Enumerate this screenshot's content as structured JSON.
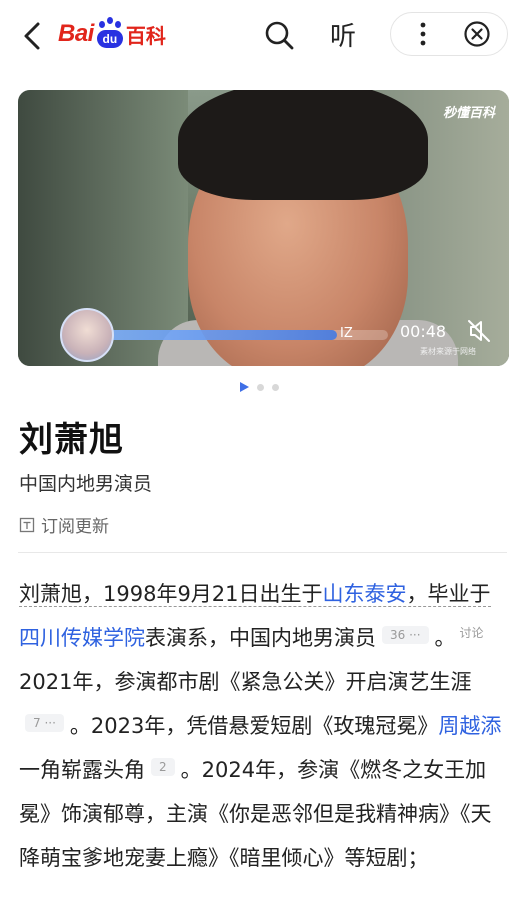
{
  "header": {
    "logo_bai": "Bai",
    "logo_du": "du",
    "logo_baike": "百科",
    "listen_label": "听"
  },
  "video": {
    "watermark": "秒懂百科",
    "marker": "IZ",
    "time": "00:48",
    "credit": "素材来源于网络",
    "progress": 0.83
  },
  "carousel": {
    "count": 3,
    "active": 0
  },
  "entry": {
    "title": "刘萧旭",
    "subtitle": "中国内地男演员",
    "subscribe_label": "订阅更新"
  },
  "paragraph": {
    "s1": "刘萧旭，",
    "s2": "1998年9月21日出生于",
    "link_place": "山东泰安",
    "s3": "，毕业于",
    "link_school": "四川传媒学院",
    "s4": "表演系，中国内地男演员",
    "ref1": "36 ···",
    "s5": "。",
    "discuss": "讨论",
    "s6": "2021年，参演都市剧《紧急公关》开启演艺生涯",
    "ref2": "7 ···",
    "s7": "。2023年，凭借悬爱短剧《玫瑰冠冕》",
    "link_person": "周越添",
    "s8": "一角崭露头角",
    "ref3": "2",
    "s9": "。2024年，参演《燃冬之女王加冕》饰演郁尊，主演《你是恶邻但是我精神病》《天降萌宝爹地宠妻上瘾》《暗里倾心》等短剧；"
  },
  "colors": {
    "brand_red": "#e1251b",
    "brand_blue": "#2932e1",
    "link": "#2f62e0"
  }
}
